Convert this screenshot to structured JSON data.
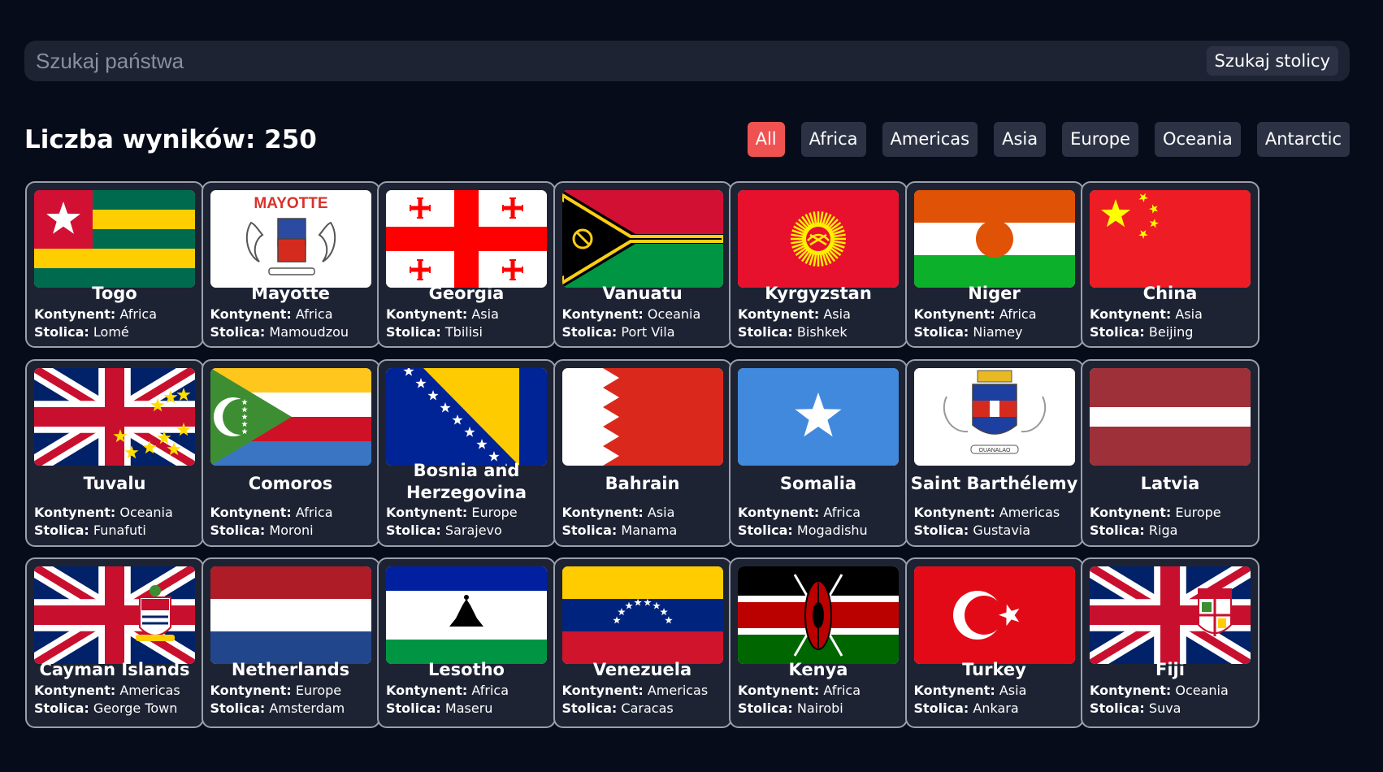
{
  "search": {
    "placeholder": "Szukaj państwa",
    "capital_button": "Szukaj stolicy"
  },
  "results": {
    "label": "Liczba wyników: 250"
  },
  "filters": [
    {
      "label": "All",
      "active": true
    },
    {
      "label": "Africa"
    },
    {
      "label": "Americas"
    },
    {
      "label": "Asia"
    },
    {
      "label": "Europe"
    },
    {
      "label": "Oceania"
    },
    {
      "label": "Antarctic"
    }
  ],
  "labels": {
    "continent": "Kontynent:",
    "capital": "Stolica:"
  },
  "countries": [
    {
      "name": "Togo",
      "continent": "Africa",
      "capital": "Lomé",
      "flag": "togo"
    },
    {
      "name": "Mayotte",
      "continent": "Africa",
      "capital": "Mamoudzou",
      "flag": "mayotte",
      "flag_text": "MAYOTTE"
    },
    {
      "name": "Georgia",
      "continent": "Asia",
      "capital": "Tbilisi",
      "flag": "georgia"
    },
    {
      "name": "Vanuatu",
      "continent": "Oceania",
      "capital": "Port Vila",
      "flag": "vanuatu"
    },
    {
      "name": "Kyrgyzstan",
      "continent": "Asia",
      "capital": "Bishkek",
      "flag": "kyrgyzstan"
    },
    {
      "name": "Niger",
      "continent": "Africa",
      "capital": "Niamey",
      "flag": "niger"
    },
    {
      "name": "China",
      "continent": "Asia",
      "capital": "Beijing",
      "flag": "china"
    },
    {
      "name": "Tuvalu",
      "continent": "Oceania",
      "capital": "Funafuti",
      "flag": "tuvalu"
    },
    {
      "name": "Comoros",
      "continent": "Africa",
      "capital": "Moroni",
      "flag": "comoros"
    },
    {
      "name": "Bosnia and Herzegovina",
      "continent": "Europe",
      "capital": "Sarajevo",
      "flag": "bosnia"
    },
    {
      "name": "Bahrain",
      "continent": "Asia",
      "capital": "Manama",
      "flag": "bahrain"
    },
    {
      "name": "Somalia",
      "continent": "Africa",
      "capital": "Mogadishu",
      "flag": "somalia"
    },
    {
      "name": "Saint Barthélemy",
      "continent": "Americas",
      "capital": "Gustavia",
      "flag": "stbarth",
      "flag_text": "OUANALAO"
    },
    {
      "name": "Latvia",
      "continent": "Europe",
      "capital": "Riga",
      "flag": "latvia"
    },
    {
      "name": "Cayman Islands",
      "continent": "Americas",
      "capital": "George Town",
      "flag": "cayman"
    },
    {
      "name": "Netherlands",
      "continent": "Europe",
      "capital": "Amsterdam",
      "flag": "netherlands"
    },
    {
      "name": "Lesotho",
      "continent": "Africa",
      "capital": "Maseru",
      "flag": "lesotho"
    },
    {
      "name": "Venezuela",
      "continent": "Americas",
      "capital": "Caracas",
      "flag": "venezuela"
    },
    {
      "name": "Kenya",
      "continent": "Africa",
      "capital": "Nairobi",
      "flag": "kenya"
    },
    {
      "name": "Turkey",
      "continent": "Asia",
      "capital": "Ankara",
      "flag": "turkey"
    },
    {
      "name": "Fiji",
      "continent": "Oceania",
      "capital": "Suva",
      "flag": "fiji"
    }
  ]
}
